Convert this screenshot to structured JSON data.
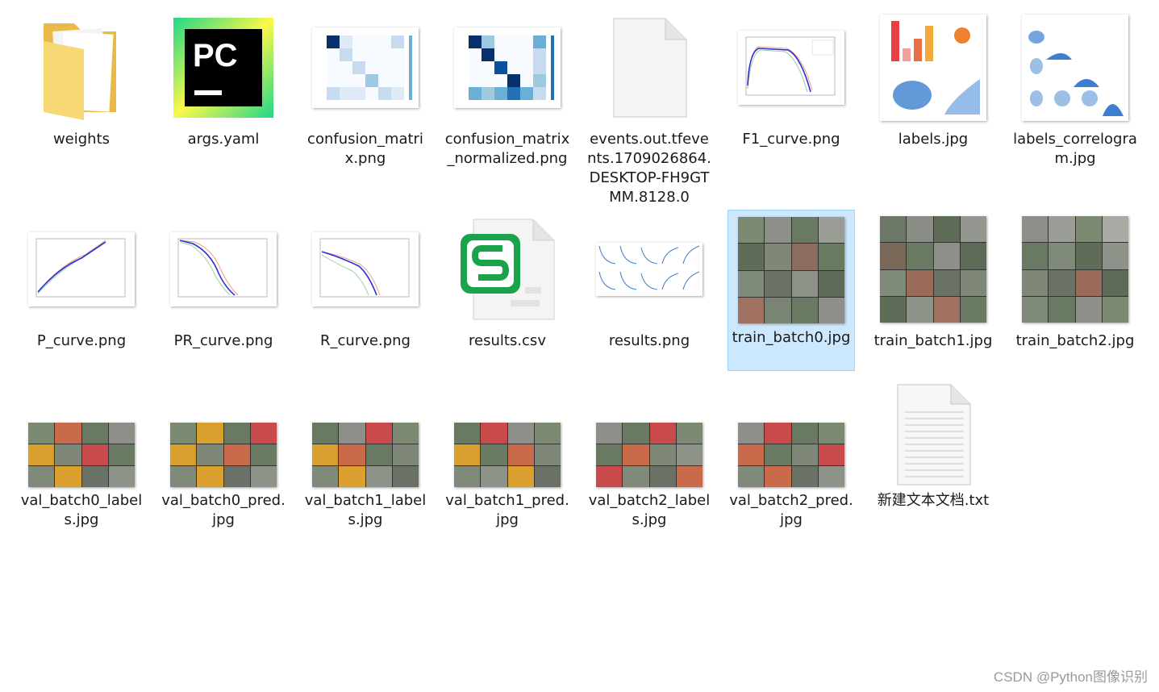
{
  "files": [
    {
      "name": "weights",
      "icon": "folder-icon"
    },
    {
      "name": "args.yaml",
      "icon": "pycharm-icon"
    },
    {
      "name": "confusion_matrix.png",
      "icon": "confusion-matrix-thumbnail"
    },
    {
      "name": "confusion_matrix_normalized.png",
      "icon": "confusion-matrix-normalized-thumbnail"
    },
    {
      "name": "events.out.tfevents.1709026864.DESKTOP-FH9GTMM.8128.0",
      "icon": "blank-file-icon"
    },
    {
      "name": "F1_curve.png",
      "icon": "curve-thumbnail"
    },
    {
      "name": "labels.jpg",
      "icon": "labels-thumbnail"
    },
    {
      "name": "labels_correlogram.jpg",
      "icon": "correlogram-thumbnail"
    },
    {
      "name": "P_curve.png",
      "icon": "curve-thumbnail"
    },
    {
      "name": "PR_curve.png",
      "icon": "curve-thumbnail"
    },
    {
      "name": "R_curve.png",
      "icon": "curve-thumbnail"
    },
    {
      "name": "results.csv",
      "icon": "spreadsheet-icon"
    },
    {
      "name": "results.png",
      "icon": "results-thumbnail"
    },
    {
      "name": "train_batch0.jpg",
      "icon": "photo-mosaic-thumbnail",
      "selected": true
    },
    {
      "name": "train_batch1.jpg",
      "icon": "photo-mosaic-thumbnail"
    },
    {
      "name": "train_batch2.jpg",
      "icon": "photo-mosaic-thumbnail"
    },
    {
      "name": "val_batch0_labels.jpg",
      "icon": "photo-mosaic-thumbnail"
    },
    {
      "name": "val_batch0_pred.jpg",
      "icon": "photo-mosaic-thumbnail"
    },
    {
      "name": "val_batch1_labels.jpg",
      "icon": "photo-mosaic-thumbnail"
    },
    {
      "name": "val_batch1_pred.jpg",
      "icon": "photo-mosaic-thumbnail"
    },
    {
      "name": "val_batch2_labels.jpg",
      "icon": "photo-mosaic-thumbnail"
    },
    {
      "name": "val_batch2_pred.jpg",
      "icon": "photo-mosaic-thumbnail"
    },
    {
      "name": "新建文本文档.txt",
      "icon": "text-file-icon"
    }
  ],
  "watermark": "CSDN @Python图像识别",
  "colors": {
    "selection": "#cce8ff",
    "selection_border": "#99d1ff",
    "folder": "#f8d775",
    "pycharm_green": "#21d789",
    "spreadsheet_green": "#1aa34a"
  }
}
